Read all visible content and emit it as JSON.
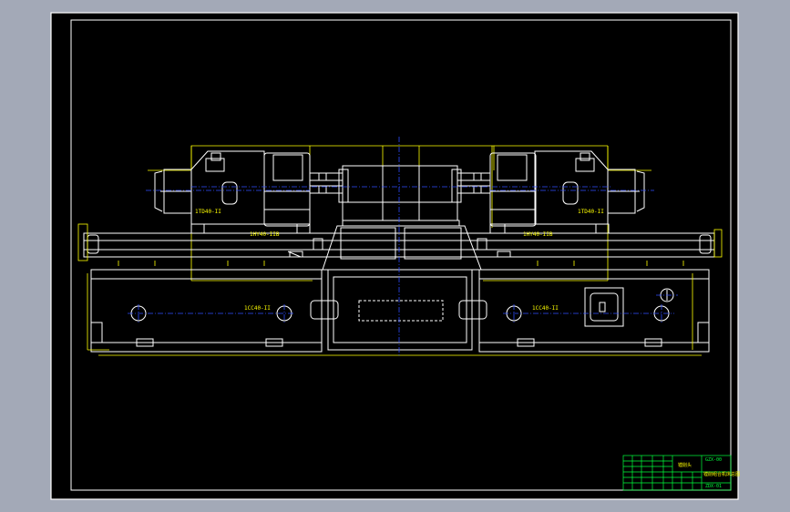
{
  "colors": {
    "background": "#a3a9b7",
    "paper": "#000000",
    "frame": "#ffffff",
    "yellow_lines": "#ffff00",
    "blue_centerlines": "#2f4dff",
    "title_block_green": "#00ff3c"
  },
  "labels": {
    "left_head": "1TD40-II",
    "right_head": "1TD40-II",
    "left_slide": "1HY40-IIB",
    "right_slide": "1HY40-IIB",
    "left_base": "1CC40-II",
    "right_base": "1CC40-II"
  },
  "title_block": {
    "school": "镗削头",
    "drawing_title": "镗削组合机床总图",
    "top_right": "GZX-00",
    "drawing_no": "ZDX-01"
  }
}
